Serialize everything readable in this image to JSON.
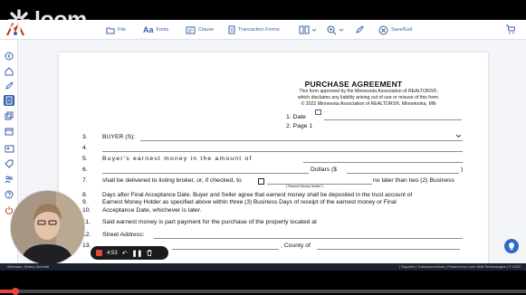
{
  "toolbar": {
    "file": "File",
    "fonts": "Fonts",
    "clause": "Clause",
    "transaction_forms": "Transaction Forms",
    "save_exit": "Save/Exit"
  },
  "document": {
    "title": "PURCHASE AGREEMENT",
    "sub1": "This form approved by the Minnesota Association of REALTORS®,",
    "sub2": "which disclaims any liability arising out of use or misuse of this form.",
    "sub3": "© 2022 Minnesota Association of REALTORS®, Minnetonka, MN",
    "date_label": "1. Date",
    "page_label": "2. Page 1",
    "lines": [
      {
        "num": "3.",
        "text": "BUYER (S):"
      },
      {
        "num": "4.",
        "text": ""
      },
      {
        "num": "5.",
        "text": "Buyer's earnest money in the amount of"
      },
      {
        "num": "6.",
        "text": "Dollars ($"
      },
      {
        "num": "7.",
        "text": "shall be delivered to listing broker, or, if checked, to"
      },
      {
        "num": "8.",
        "text": "Days after Final Acceptance Date. Buyer and Seller agree that earnest money shall be deposited in the trust account of"
      },
      {
        "num": "9.",
        "text": "Earnest Money Holder as specified above within three (3) Business Days of receipt of the earnest money or Final"
      },
      {
        "num": "10.",
        "text": "Acceptance Date, whichever is later."
      },
      {
        "num": "11.",
        "text": "Said earnest money is part payment for the purchase of the property located at"
      },
      {
        "num": "12.",
        "text": "Street Address:"
      },
      {
        "num": "13.",
        "text": ""
      }
    ],
    "line6_suffix": ")",
    "line7_suffix": "no later than two (2) Business",
    "earnest_holder_caption": "(\"Earnest Money Holder\")",
    "county_label": ", County of"
  },
  "loom": {
    "word": "loom"
  },
  "recorder": {
    "time": "4:53"
  },
  "footer": {
    "left": "Welcome, Sherry Schmidt",
    "right": "| Español | TransactionDesk | Powered by Lone Wolf Technologies | © 2022"
  },
  "progress": {
    "fraction": 0.03
  },
  "colors": {
    "accent": "#2f5dab",
    "record": "#e8453c"
  }
}
